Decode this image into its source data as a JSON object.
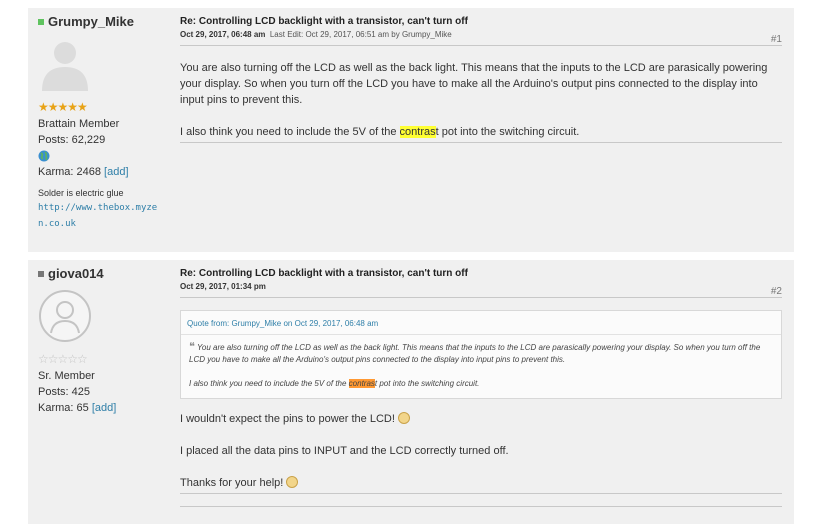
{
  "posts": [
    {
      "author": "Grumpy_Mike",
      "status_color": "#5fc35f",
      "rank": "Brattain Member",
      "posts_label": "Posts: 62,229",
      "karma_label": "Karma: 2468",
      "karma_add": "[add]",
      "signature": "Solder is electric glue",
      "signature_link": "http://www.thebox.myzen.co.uk",
      "subject": "Re: Controlling LCD backlight with a transistor, can't turn off",
      "date": "Oct 29, 2017, 06:48 am",
      "edit_prefix": "Last Edit:",
      "edit_info": "Oct 29, 2017, 06:51 am by Grumpy_Mike",
      "number": "#1",
      "paragraph1": "You are also turning off the LCD as well as the back light. This means that the inputs to the LCD are parasically powering your display. So when you turn off the LCD you have to make all the Arduino's output pins connected to the display into input pins to prevent this.",
      "p2_before": "I also think you need to include the 5V of the ",
      "p2_highlight": "contras",
      "p2_after": "t pot into the switching circuit."
    },
    {
      "author": "giova014",
      "status_color": "#777777",
      "rank": "Sr. Member",
      "posts_label": "Posts: 425",
      "karma_label": "Karma: 65",
      "karma_add": "[add]",
      "subject": "Re: Controlling LCD backlight with a transistor, can't turn off",
      "date": "Oct 29, 2017, 01:34 pm",
      "number": "#2",
      "quote_header": "Quote from: Grumpy_Mike on Oct 29, 2017, 06:48 am",
      "quote_p1": "You are also turning off the LCD as well as the back light. This means that the inputs to the LCD are parasically powering your display. So when you turn off the LCD you have to make all the Arduino's output pins connected to the display into input pins to prevent this.",
      "quote_p2_before": "I also think you need to include the 5V of the ",
      "quote_p2_highlight": "contras",
      "quote_p2_after": "t pot into the switching circuit.",
      "reply1": "I wouldn't expect the pins to power the LCD!",
      "reply2": "I placed all the data pins to INPUT and the LCD correctly turned off.",
      "reply3": "Thanks for your help!"
    }
  ]
}
